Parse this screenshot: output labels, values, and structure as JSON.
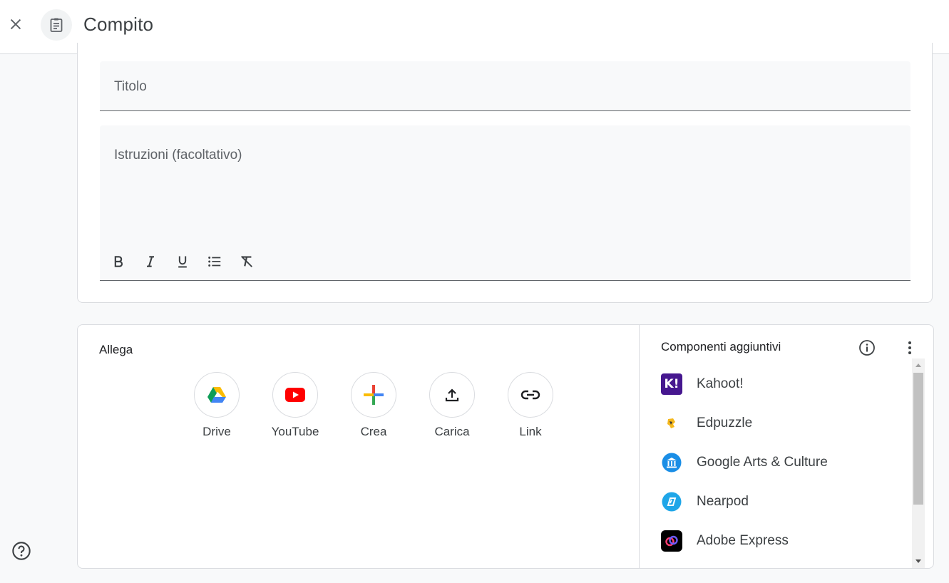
{
  "header": {
    "title": "Compito",
    "close_icon": "close-icon",
    "doc_icon": "assignment-icon"
  },
  "form": {
    "title_placeholder": "Titolo",
    "instructions_placeholder": "Istruzioni (facoltativo)",
    "toolbar": [
      "bold-icon",
      "italic-icon",
      "underline-icon",
      "bulleted-list-icon",
      "clear-formatting-icon"
    ]
  },
  "attach": {
    "label": "Allega",
    "items": [
      {
        "label": "Drive",
        "icon": "google-drive-icon"
      },
      {
        "label": "YouTube",
        "icon": "youtube-icon"
      },
      {
        "label": "Crea",
        "icon": "plus-icon"
      },
      {
        "label": "Carica",
        "icon": "upload-icon"
      },
      {
        "label": "Link",
        "icon": "link-icon"
      }
    ]
  },
  "addons": {
    "title": "Componenti aggiuntivi",
    "items": [
      {
        "name": "Kahoot!",
        "logo_text": "K!",
        "color": "#46178f"
      },
      {
        "name": "Edpuzzle",
        "color": "#f5b81d"
      },
      {
        "name": "Google Arts & Culture",
        "color": "#1a8ee6"
      },
      {
        "name": "Nearpod",
        "color": "#1fa6e8"
      },
      {
        "name": "Adobe Express",
        "color": "#000000"
      }
    ]
  },
  "colors": {
    "text": "#3c4043",
    "border": "#dadce0",
    "field_bg": "#f8f9fa"
  }
}
